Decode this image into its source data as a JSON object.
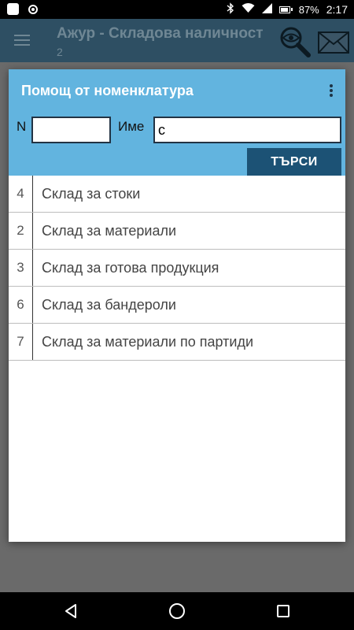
{
  "status_bar": {
    "battery": "87%",
    "time": "2:17"
  },
  "app_bar": {
    "title": "Ажур - Складова наличност",
    "subtitle": "2",
    "menu_icon": "hamburger-icon",
    "view_icon": "eye-magnifier-icon",
    "mail_icon": "envelope-icon"
  },
  "dialog": {
    "title": "Помощ от номенклатура",
    "more_icon": "kebab-menu-icon",
    "n_label": "N",
    "n_value": "",
    "name_label": "Име",
    "name_value": "с",
    "search_label": "ТЪРСИ",
    "items": [
      {
        "id": "4",
        "name": "Склад за стоки"
      },
      {
        "id": "2",
        "name": "Склад за материали"
      },
      {
        "id": "3",
        "name": "Склад за готова продукция"
      },
      {
        "id": "6",
        "name": "Склад за бандероли"
      },
      {
        "id": "7",
        "name": "Склад за материали по партиди"
      }
    ]
  },
  "colors": {
    "dialog_header": "#62b4df",
    "button": "#1c5275",
    "app_bar": "#2e4f63"
  }
}
